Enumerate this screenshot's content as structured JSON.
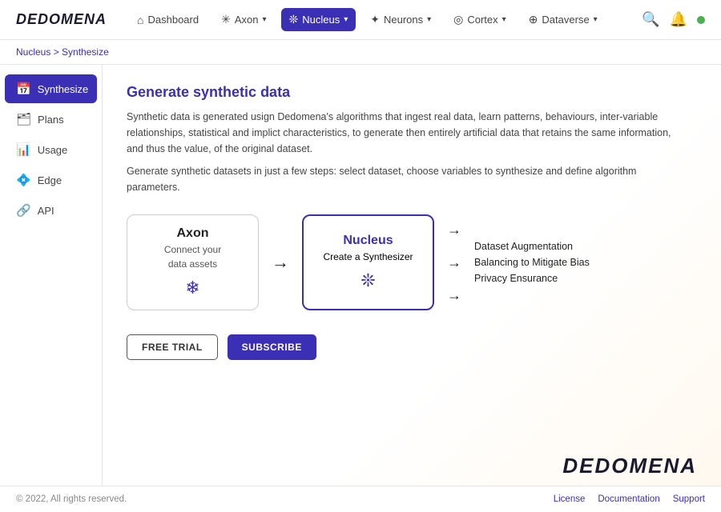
{
  "app": {
    "logo": "DEDOMENA",
    "bottom_logo": "DEDOMENA"
  },
  "topnav": {
    "dashboard_label": "Dashboard",
    "axon_label": "Axon",
    "nucleus_label": "Nucleus",
    "neurons_label": "Neurons",
    "cortex_label": "Cortex",
    "dataverse_label": "Dataverse"
  },
  "breadcrumb": {
    "parent": "Nucleus",
    "separator": " > ",
    "current": "Synthesize"
  },
  "sidebar": {
    "items": [
      {
        "label": "Synthesize",
        "icon": "📅",
        "active": true
      },
      {
        "label": "Plans",
        "icon": "🗂",
        "active": false
      },
      {
        "label": "Usage",
        "icon": "📊",
        "active": false
      },
      {
        "label": "Edge",
        "icon": "💠",
        "active": false
      },
      {
        "label": "API",
        "icon": "🔗",
        "active": false
      }
    ]
  },
  "content": {
    "title": "Generate synthetic data",
    "description1": "Synthetic data is generated usign Dedomena's algorithms that ingest real data, learn patterns, behaviours, inter-variable relationships, statistical and implict characteristics, to generate then entirely artificial data that retains the same information, and thus the value, of the original dataset.",
    "description2": "Generate synthetic datasets in just a few steps: select dataset, choose variables to synthesize and define algorithm parameters.",
    "diagram": {
      "axon_box": {
        "title": "Axon",
        "subtitle": "Connect your",
        "subtitle2": "data assets"
      },
      "nucleus_box": {
        "title": "Nucleus",
        "subtitle": "Create a Synthesizer"
      },
      "outputs": [
        "Dataset Augmentation",
        "Balancing to Mitigate Bias",
        "Privacy Ensurance"
      ]
    },
    "buttons": {
      "free_trial": "FREE TRIAL",
      "subscribe": "SUBSCRIBE"
    }
  },
  "footer": {
    "copyright": "© 2022, All rights reserved.",
    "links": [
      "License",
      "Documentation",
      "Support"
    ]
  }
}
